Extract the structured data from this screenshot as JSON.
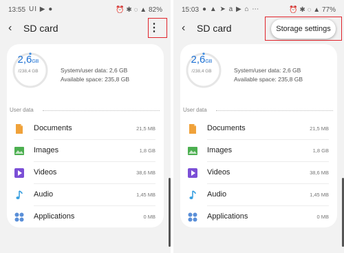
{
  "left": {
    "status": {
      "time": "13:55",
      "notif_icons": "UI ▶ ●",
      "system": "⏰ ✱ ◌ ▲ 82%"
    },
    "title": "SD card",
    "storage": {
      "used": "2,6",
      "used_unit": "GB",
      "total": "/238,4 GB",
      "system_line": "System/user data: 2,6 GB",
      "available_line": "Available space: 235,8 GB"
    },
    "section_label": "User data",
    "items": [
      {
        "label": "Documents",
        "size": "21,5 MB",
        "icon": "document-icon",
        "color": "#f0a23a"
      },
      {
        "label": "Images",
        "size": "1,8 GB",
        "icon": "image-icon",
        "color": "#4caf50"
      },
      {
        "label": "Videos",
        "size": "38,6 MB",
        "icon": "video-icon",
        "color": "#7b4fd6"
      },
      {
        "label": "Audio",
        "size": "1,45 MB",
        "icon": "music-icon",
        "color": "#3aa0e0"
      },
      {
        "label": "Applications",
        "size": "0 MB",
        "icon": "apps-icon",
        "color": "#5a8fd8"
      }
    ]
  },
  "right": {
    "status": {
      "time": "15:03",
      "notif_icons": "● ▲ ➤ a ▶ ⌂ ⋯",
      "system": "⏰ ✱ ◌ ▲ 77%"
    },
    "title": "SD card",
    "menu_item": "Storage settings",
    "storage": {
      "used": "2,6",
      "used_unit": "GB",
      "total": "/238,4 GB",
      "system_line": "System/user data: 2,6 GB",
      "available_line": "Available space: 235,8 GB"
    },
    "section_label": "User data",
    "items": [
      {
        "label": "Documents",
        "size": "21,5 MB"
      },
      {
        "label": "Images",
        "size": "1,8 GB"
      },
      {
        "label": "Videos",
        "size": "38,6 MB"
      },
      {
        "label": "Audio",
        "size": "1,45 MB"
      },
      {
        "label": "Applications",
        "size": "0 MB"
      }
    ]
  },
  "colors": {
    "accent": "#1a6fd3",
    "highlight": "#e0232a"
  }
}
